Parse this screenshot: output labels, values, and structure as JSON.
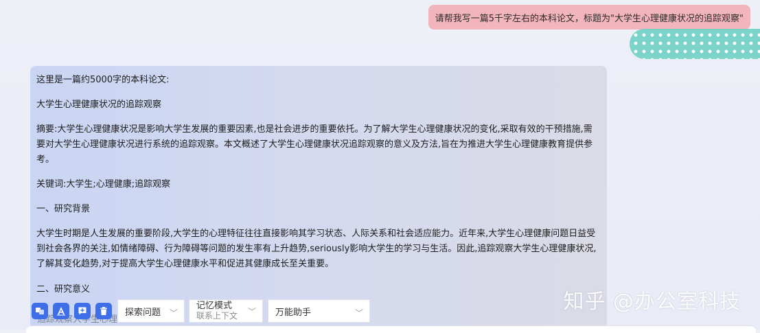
{
  "user_message": "请帮我写一篇5千字左右的本科论文，标题为\"大学生心理健康状况的追踪观察\"",
  "reply": {
    "intro": "这里是一篇约5000字的本科论文:",
    "title": "大学生心理健康状况的追踪观察",
    "abstract": "摘要:大学生心理健康状况是影响大学生发展的重要因素,也是社会进步的重要依托。为了解大学生心理健康状况的变化,采取有效的干预措施,需要对大学生心理健康状况进行系统的追踪观察。本文概述了大学生心理健康状况追踪观察的意义及方法,旨在为推进大学生心理健康教育提供参考。",
    "keywords": "关键词:大学生;心理健康;追踪观察",
    "section1_heading": "一、研究背景",
    "section1_body": "大学生时期是人生发展的重要阶段,大学生的心理特征往往直接影响其学习状态、人际关系和社会适应能力。近年来,大学生心理健康问题日益受到社会各界的关注,如情绪障碍、行为障碍等问题的发生率有上升趋势,seriously影响大学生的学习与生活。因此,追踪观察大学生心理健康状况,了解其变化趋势,对于提高大学生心理健康水平和促进其健康成长至关重要。",
    "section2_heading": "二、研究意义",
    "partial_line": "追踪观察大学生心理状"
  },
  "toolbar": {
    "icons": [
      "translate-icon",
      "a-text-icon",
      "message-plus-icon",
      "trash-icon"
    ],
    "search_label": "探索问题",
    "memory_label": "记忆模式",
    "memory_sub": "联系上下文",
    "assistant_label": "万能助手",
    "caret": "﹀"
  },
  "watermark": "知乎 @办公室科技",
  "colors": {
    "accent": "#3e6ee8",
    "user_bubble": "#f3b5bd"
  }
}
